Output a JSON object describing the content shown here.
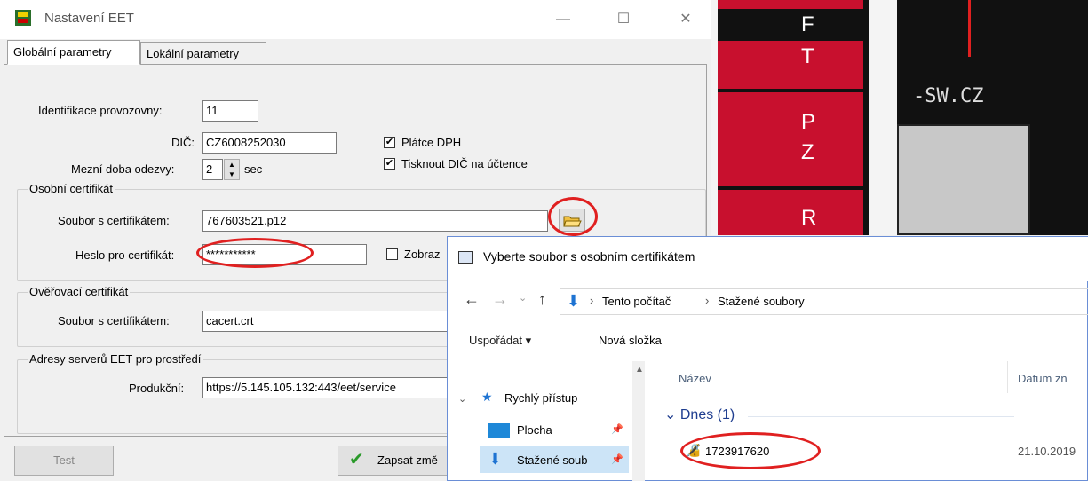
{
  "eet": {
    "title": "Nastavení EET",
    "tabs": [
      "Globální parametry",
      "Lokální parametry"
    ],
    "id_label": "Identifikace provozovny:",
    "id_value": "11",
    "dic_label": "DIČ:",
    "dic_value": "CZ6008252030",
    "platce_label": "Plátce DPH",
    "tisk_label": "Tisknout DIČ na účtence",
    "timeout_label": "Mezní doba odezvy:",
    "timeout_value": "2",
    "timeout_unit": "sec",
    "personal_group": "Osobní certifikát",
    "cert_file_label": "Soubor s certifikátem:",
    "cert_file_value": "767603521.p12",
    "password_label": "Heslo pro certifikát:",
    "password_value": "***********",
    "show_label": "Zobraz",
    "verify_group": "Ověřovací certifikát",
    "verify_file_label": "Soubor s certifikátem:",
    "verify_file_value": "cacert.crt",
    "servers_group": "Adresy serverů EET pro prostředí",
    "prod_label": "Produkční:",
    "prod_value": "https://5.145.105.132:443/eet/service",
    "test_button": "Test",
    "save_button": "Zapsat změ"
  },
  "strip": {
    "letters": [
      "F",
      "T",
      "P",
      "Z",
      "R"
    ],
    "text": "-SW.CZ"
  },
  "filedialog": {
    "title": "Vyberte soubor s osobním certifikátem",
    "path": [
      "Tento počítač",
      "Stažené soubory"
    ],
    "organize": "Uspořádat",
    "new_folder": "Nová složka",
    "nav": [
      "Rychlý přístup",
      "Plocha",
      "Stažené soub"
    ],
    "col_name": "Název",
    "col_date": "Datum zn",
    "group": "Dnes (1)",
    "file_name": "1723917620",
    "file_date": "21.10.2019"
  },
  "colors": {
    "accent": "#e02020",
    "strip_red": "#c8102e",
    "folder_blue": "#1e73d2"
  }
}
